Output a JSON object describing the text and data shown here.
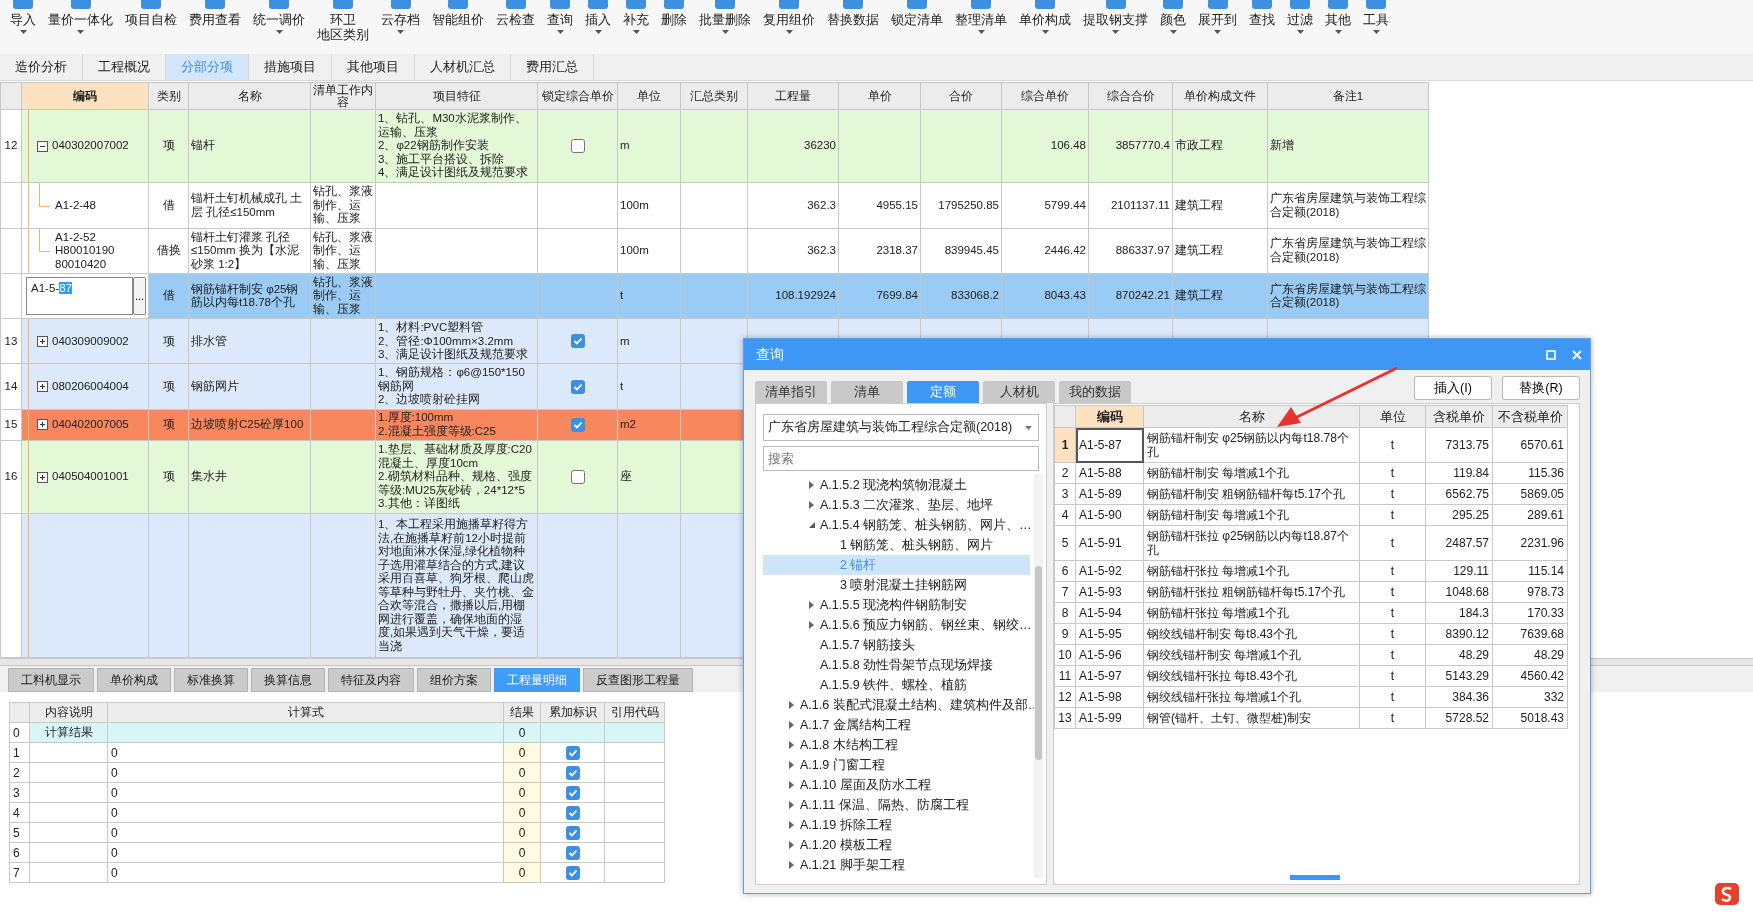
{
  "toolbar": [
    {
      "label": "导入",
      "menu": true
    },
    {
      "label": "量价一体化",
      "menu": true
    },
    {
      "label": "项目自检",
      "menu": false
    },
    {
      "label": "费用查看",
      "menu": false
    },
    {
      "label": "统一调价",
      "menu": true
    },
    {
      "label": "环卫",
      "sublabel": "地区类别",
      "menu": false
    },
    {
      "label": "云存档",
      "menu": true
    },
    {
      "label": "智能组价",
      "menu": false
    },
    {
      "label": "云检查",
      "menu": false
    },
    {
      "label": "查询",
      "menu": true
    },
    {
      "label": "插入",
      "menu": true
    },
    {
      "label": "补充",
      "menu": true
    },
    {
      "label": "删除",
      "menu": false
    },
    {
      "label": "批量删除",
      "menu": true
    },
    {
      "label": "复用组价",
      "menu": true
    },
    {
      "label": "替换数据",
      "menu": false
    },
    {
      "label": "锁定清单",
      "menu": false
    },
    {
      "label": "整理清单",
      "menu": true
    },
    {
      "label": "单价构成",
      "menu": true
    },
    {
      "label": "提取钢支撑",
      "menu": true
    },
    {
      "label": "颜色",
      "menu": true
    },
    {
      "label": "展开到",
      "menu": true
    },
    {
      "label": "查找",
      "menu": false
    },
    {
      "label": "过滤",
      "menu": true
    },
    {
      "label": "其他",
      "menu": true
    },
    {
      "label": "工具",
      "menu": true
    }
  ],
  "tabs": [
    {
      "label": "造价分析",
      "selected": false
    },
    {
      "label": "工程概况",
      "selected": false
    },
    {
      "label": "分部分项",
      "selected": true
    },
    {
      "label": "措施项目",
      "selected": false
    },
    {
      "label": "其他项目",
      "selected": false
    },
    {
      "label": "人材机汇总",
      "selected": false
    },
    {
      "label": "费用汇总",
      "selected": false
    }
  ],
  "main_table": {
    "columns": [
      "编码",
      "类别",
      "名称",
      "清单工作内容",
      "项目特征",
      "锁定综合单价",
      "单位",
      "汇总类别",
      "工程量",
      "单价",
      "合价",
      "综合单价",
      "综合合价",
      "单价构成文件",
      "备注1"
    ],
    "rows": [
      {
        "kind": "item",
        "number": "12",
        "code": "040302007002",
        "expanded": true,
        "category": "项",
        "name": "锚杆",
        "features": "1、钻孔、M30水泥浆制作、运输、压浆\n2、φ22钢筋制作安装\n3、施工平台搭设、拆除\n4、满足设计图纸及规范要求",
        "locked": false,
        "unit": "m",
        "quantity": "36230",
        "comp_price": "106.48",
        "comp_total": "3857770.4",
        "price_file": "市政工程",
        "remark": "新增",
        "color": "#e2f8d6"
      },
      {
        "kind": "sub",
        "code": "A1-2-48",
        "category": "借",
        "name": "锚杆土钉机械成孔 土层 孔径≤150mm",
        "work": "钻孔、浆液制作、运输、压浆",
        "unit": "100m",
        "quantity": "362.3",
        "price": "4955.15",
        "total": "1795250.85",
        "comp_price": "5799.44",
        "comp_total": "2101137.11",
        "price_file": "建筑工程",
        "remark": "广东省房屋建筑与装饰工程综合定额(2018)",
        "color": "#ffffff"
      },
      {
        "kind": "sub",
        "code": "A1-2-52\nH80010190\n80010420",
        "category": "借换",
        "name": "锚杆土钉灌浆 孔径≤150mm 换为【水泥砂浆 1:2】",
        "work": "钻孔、浆液制作、运输、压浆",
        "unit": "100m",
        "quantity": "362.3",
        "price": "2318.37",
        "total": "839945.45",
        "comp_price": "2446.42",
        "comp_total": "886337.97",
        "price_file": "建筑工程",
        "remark": "广东省房屋建筑与装饰工程综合定额(2018)",
        "color": "#ffffff"
      },
      {
        "kind": "editing",
        "code": "A1-5-",
        "code_highlight": "87",
        "picker": "...",
        "category": "借",
        "name": "钢筋锚杆制安 φ25钢筋以内每t18.78个孔",
        "work": "钻孔、浆液制作、运输、压浆",
        "unit": "t",
        "quantity": "108.192924",
        "price": "7699.84",
        "total": "833068.2",
        "comp_price": "8043.43",
        "comp_total": "870242.21",
        "price_file": "建筑工程",
        "remark": "广东省房屋建筑与装饰工程综合定额(2018)",
        "color": "#99cbf5"
      },
      {
        "kind": "item",
        "number": "13",
        "code": "040309009002",
        "expanded": false,
        "category": "项",
        "name": "排水管",
        "features": "1、材料:PVC塑料管\n2、管径:Φ100mm×3.2mm\n3、满足设计图纸及规范要求",
        "locked": true,
        "unit": "m",
        "color": "#dce9fb"
      },
      {
        "kind": "item",
        "number": "14",
        "code": "080206004004",
        "expanded": false,
        "category": "项",
        "name": "钢筋网片",
        "features": "1、钢筋规格：φ6@150*150钢筋网\n2、边坡喷射砼挂网",
        "locked": true,
        "unit": "t",
        "color": "#dce9fb"
      },
      {
        "kind": "item",
        "number": "15",
        "code": "040402007005",
        "expanded": false,
        "category": "项",
        "name": "边坡喷射C25砼厚100",
        "features": "1.厚度:100mm\n2.混凝土强度等级:C25",
        "locked": true,
        "unit": "m2",
        "color": "#f7875c"
      },
      {
        "kind": "item",
        "number": "16",
        "code": "040504001001",
        "expanded": false,
        "category": "项",
        "name": "集水井",
        "features": "1.垫层、基础材质及厚度:C20混凝土、厚度10cm\n2.砌筑材料品种、规格、强度等级:MU25灰砂砖，24*12*5\n3.其他：详图纸",
        "locked": false,
        "unit": "座",
        "color": "#e2f8d6"
      },
      {
        "kind": "item",
        "features": "1、本工程采用施播草籽得方法,在施播草籽前12小时提前对地面淋水保湿,绿化植物种子选用灌草结合的方式,建议采用百喜草、狗牙根、爬山虎等草种与野牡丹、夹竹桃、金合欢等混合，撒播以后,用棚网进行覆盖，确保地面的湿度,如果遇到天气干燥，要适当浇",
        "color": "#dce9fb"
      }
    ]
  },
  "bottom_tabs": [
    {
      "label": "工料机显示",
      "selected": false
    },
    {
      "label": "单价构成",
      "selected": false
    },
    {
      "label": "标准换算",
      "selected": false
    },
    {
      "label": "换算信息",
      "selected": false
    },
    {
      "label": "特征及内容",
      "selected": false
    },
    {
      "label": "组价方案",
      "selected": false
    },
    {
      "label": "工程量明细",
      "selected": true
    },
    {
      "label": "反查图形工程量",
      "selected": false
    }
  ],
  "quantity_table": {
    "columns": [
      "内容说明",
      "计算式",
      "结果",
      "累加标识",
      "引用代码"
    ],
    "rows": [
      {
        "kind": "total",
        "number": "0",
        "description": "计算结果",
        "result": "0"
      },
      {
        "kind": "entry",
        "number": "1",
        "formula": "0",
        "result": "0",
        "accumulate": true
      },
      {
        "kind": "entry",
        "number": "2",
        "formula": "0",
        "result": "0",
        "accumulate": true
      },
      {
        "kind": "entry",
        "number": "3",
        "formula": "0",
        "result": "0",
        "accumulate": true
      },
      {
        "kind": "entry",
        "number": "4",
        "formula": "0",
        "result": "0",
        "accumulate": true
      },
      {
        "kind": "entry",
        "number": "5",
        "formula": "0",
        "result": "0",
        "accumulate": true
      },
      {
        "kind": "entry",
        "number": "6",
        "formula": "0",
        "result": "0",
        "accumulate": true
      },
      {
        "kind": "entry",
        "number": "7",
        "formula": "0",
        "result": "0",
        "accumulate": true
      }
    ]
  },
  "dialog": {
    "title": "查询",
    "tabs": [
      {
        "label": "清单指引",
        "selected": false
      },
      {
        "label": "清单",
        "selected": false
      },
      {
        "label": "定额",
        "selected": true
      },
      {
        "label": "人材机",
        "selected": false
      },
      {
        "label": "我的数据",
        "selected": false
      }
    ],
    "buttons": [
      "插入(I)",
      "替换(R)"
    ],
    "library": "广东省房屋建筑与装饰工程综合定额(2018)",
    "search": {
      "placeholder": "搜索"
    },
    "tree": [
      {
        "children": [
          {
            "label": "A.1.5.2 现浇构筑物混凝土",
            "expanded": false,
            "selected": false
          },
          {
            "label": "A.1.5.3 二次灌浆、垫层、地坪",
            "expanded": false,
            "selected": false
          },
          {
            "label": "A.1.5.4 钢筋笼、桩头钢筋、网片、…",
            "expanded": true,
            "selected": false,
            "children": [
              {
                "label": "1 钢筋笼、桩头钢筋、网片",
                "selected": false
              },
              {
                "label": "2 锚杆",
                "selected": true
              },
              {
                "label": "3 喷射混凝土挂钢筋网",
                "selected": false
              }
            ]
          },
          {
            "label": "A.1.5.5 现浇构件钢筋制安",
            "expanded": false,
            "selected": false
          },
          {
            "label": "A.1.5.6 预应力钢筋、钢丝束、钢绞…",
            "expanded": false,
            "selected": false
          },
          {
            "label": "A.1.5.7 钢筋接头",
            "selected": false
          },
          {
            "label": "A.1.5.8 劲性骨架节点现场焊接",
            "selected": false
          },
          {
            "label": "A.1.5.9 铁件、螺栓、植筋",
            "selected": false
          }
        ]
      },
      {
        "label": "A.1.6 装配式混凝土结构、建筑构件及部…",
        "expanded": false,
        "selected": false
      },
      {
        "label": "A.1.7 金属结构工程",
        "expanded": false,
        "selected": false
      },
      {
        "label": "A.1.8 木结构工程",
        "expanded": false,
        "selected": false
      },
      {
        "label": "A.1.9 门窗工程",
        "expanded": false,
        "selected": false
      },
      {
        "label": "A.1.10 屋面及防水工程",
        "expanded": false,
        "selected": false
      },
      {
        "label": "A.1.11 保温、隔热、防腐工程",
        "expanded": false,
        "selected": false
      },
      {
        "label": "A.1.19 拆除工程",
        "expanded": false,
        "selected": false
      },
      {
        "label": "A.1.20 模板工程",
        "expanded": false,
        "selected": false
      },
      {
        "label": "A.1.21 脚手架工程",
        "expanded": false,
        "selected": false
      }
    ],
    "table": {
      "columns": [
        "编码",
        "名称",
        "单位",
        "含税单价",
        "不含税单价"
      ],
      "rows": [
        {
          "number": "1",
          "code": "A1-5-87",
          "name": "钢筋锚杆制安 φ25钢筋以内每t18.78个孔",
          "unit": "t",
          "tax_price": "7313.75",
          "price": "6570.61",
          "selected": true
        },
        {
          "number": "2",
          "code": "A1-5-88",
          "name": "钢筋锚杆制安 每增减1个孔",
          "unit": "t",
          "tax_price": "119.84",
          "price": "115.36",
          "selected": false
        },
        {
          "number": "3",
          "code": "A1-5-89",
          "name": "钢筋锚杆制安 粗钢筋锚杆每t5.17个孔",
          "unit": "t",
          "tax_price": "6562.75",
          "price": "5869.05",
          "selected": false
        },
        {
          "number": "4",
          "code": "A1-5-90",
          "name": "钢筋锚杆制安 每增减1个孔",
          "unit": "t",
          "tax_price": "295.25",
          "price": "289.61",
          "selected": false
        },
        {
          "number": "5",
          "code": "A1-5-91",
          "name": "钢筋锚杆张拉 φ25钢筋以内每t18.87个孔",
          "unit": "t",
          "tax_price": "2487.57",
          "price": "2231.96",
          "selected": false
        },
        {
          "number": "6",
          "code": "A1-5-92",
          "name": "钢筋锚杆张拉 每增减1个孔",
          "unit": "t",
          "tax_price": "129.11",
          "price": "115.14",
          "selected": false
        },
        {
          "number": "7",
          "code": "A1-5-93",
          "name": "钢筋锚杆张拉 粗钢筋锚杆每t5.17个孔",
          "unit": "t",
          "tax_price": "1048.68",
          "price": "978.73",
          "selected": false
        },
        {
          "number": "8",
          "code": "A1-5-94",
          "name": "钢筋锚杆张拉 每增减1个孔",
          "unit": "t",
          "tax_price": "184.3",
          "price": "170.33",
          "selected": false
        },
        {
          "number": "9",
          "code": "A1-5-95",
          "name": "钢绞线锚杆制安 每t8.43个孔",
          "unit": "t",
          "tax_price": "8390.12",
          "price": "7639.68",
          "selected": false
        },
        {
          "number": "10",
          "code": "A1-5-96",
          "name": "钢绞线锚杆制安 每增减1个孔",
          "unit": "t",
          "tax_price": "48.29",
          "price": "48.29",
          "selected": false
        },
        {
          "number": "11",
          "code": "A1-5-97",
          "name": "钢绞线锚杆张拉 每t8.43个孔",
          "unit": "t",
          "tax_price": "5143.29",
          "price": "4560.42",
          "selected": false
        },
        {
          "number": "12",
          "code": "A1-5-98",
          "name": "钢绞线锚杆张拉 每增减1个孔",
          "unit": "t",
          "tax_price": "384.36",
          "price": "332",
          "selected": false
        },
        {
          "number": "13",
          "code": "A1-5-99",
          "name": "钢管(锚杆、土钉、微型桩)制安",
          "unit": "t",
          "tax_price": "5728.52",
          "price": "5018.43",
          "selected": false
        }
      ]
    }
  }
}
